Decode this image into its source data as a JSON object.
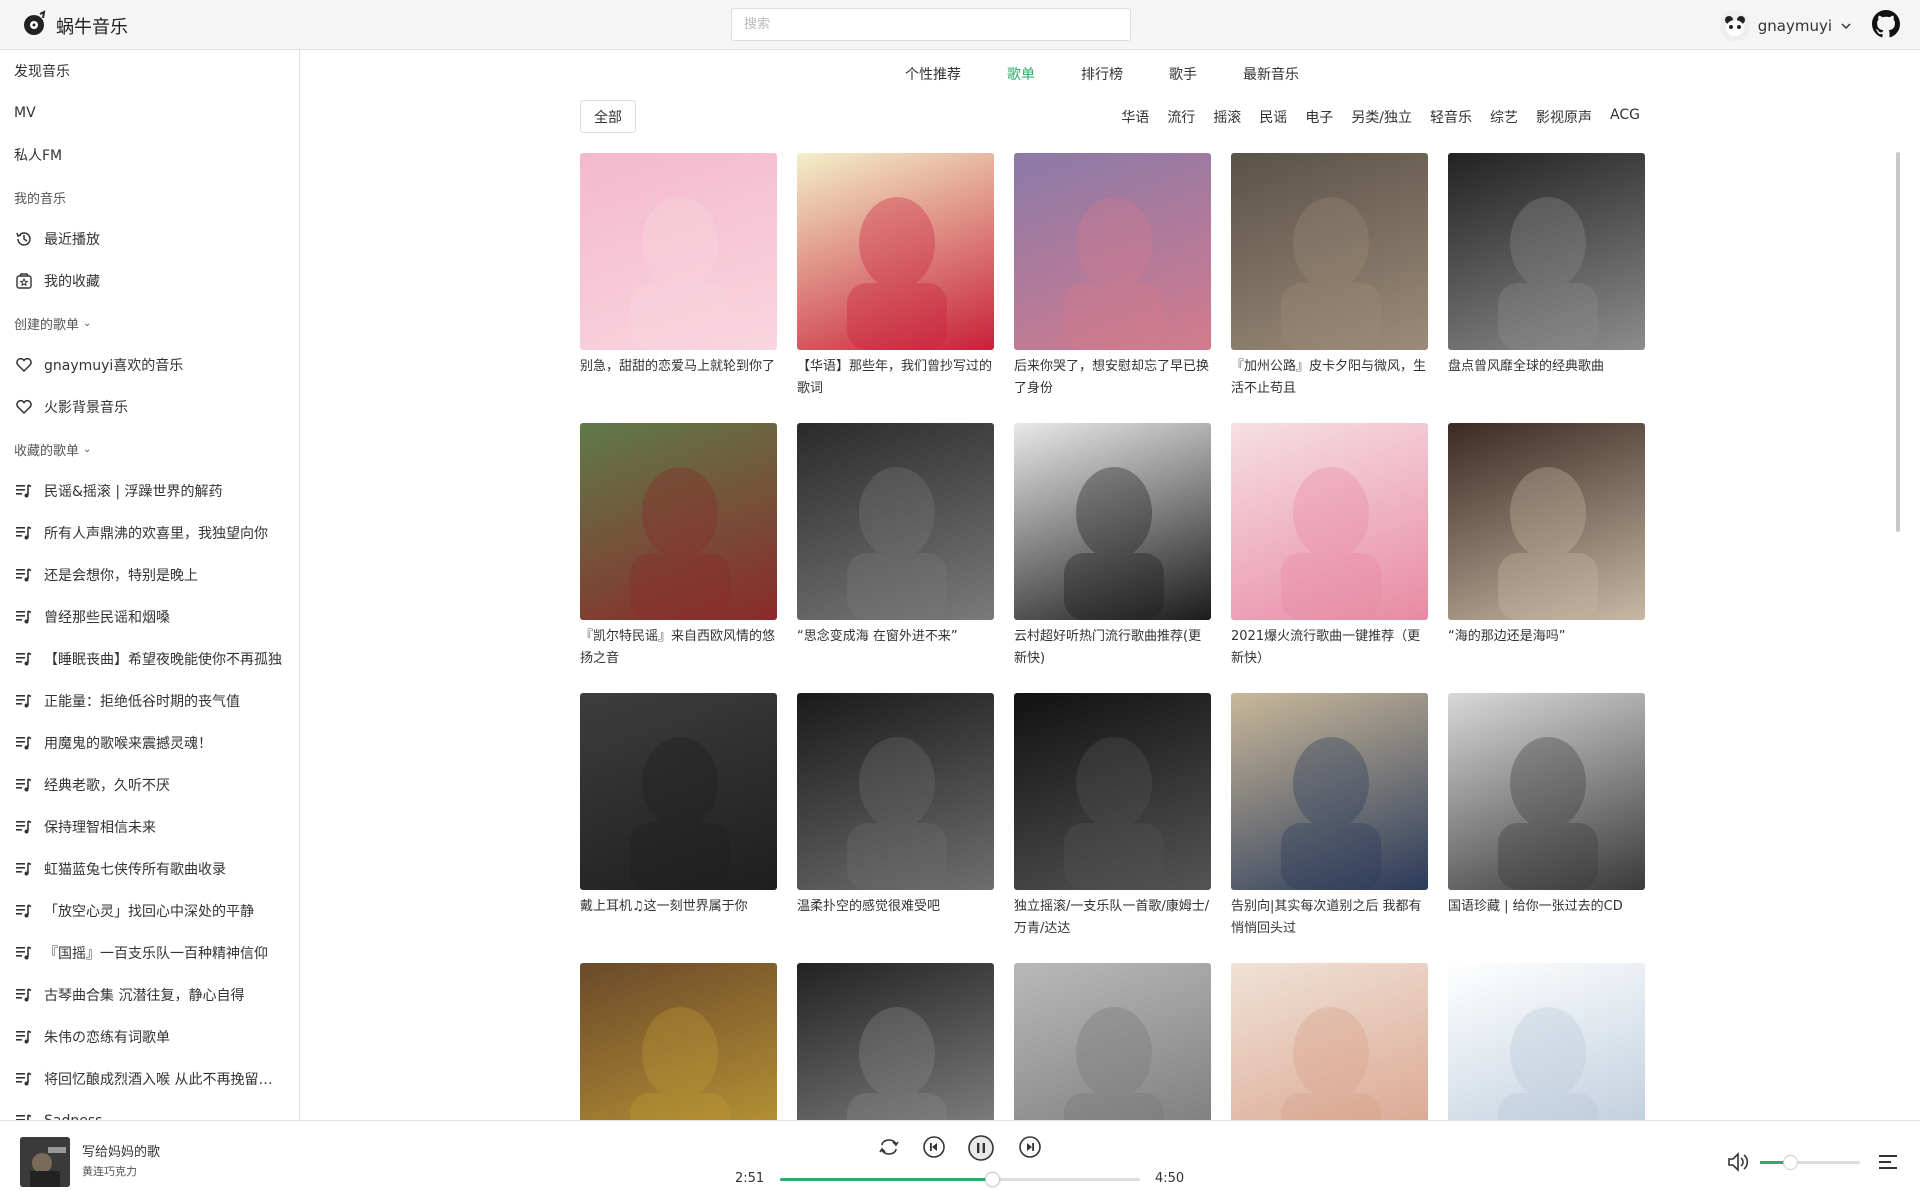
{
  "app": {
    "name": "蜗牛音乐"
  },
  "search": {
    "placeholder": "搜索"
  },
  "user": {
    "name": "gnaymuyi"
  },
  "sidebar": {
    "nav": [
      "发现音乐",
      "MV",
      "私人FM"
    ],
    "my_music_label": "我的音乐",
    "my_music": [
      {
        "label": "最近播放",
        "icon": "history-icon"
      },
      {
        "label": "我的收藏",
        "icon": "favorite-box-icon"
      }
    ],
    "created_label": "创建的歌单",
    "created": [
      "gnaymuyi喜欢的音乐",
      "火影背景音乐"
    ],
    "collected_label": "收藏的歌单",
    "collected": [
      "民谣&摇滚 | 浮躁世界的解药",
      "所有人声鼎沸的欢喜里，我独望向你",
      "还是会想你，特别是晚上",
      "曾经那些民谣和烟嗓",
      "【睡眠丧曲】希望夜晚能使你不再孤独",
      "正能量：拒绝低谷时期的丧气值",
      "用魔鬼的歌喉来震撼灵魂！",
      "经典老歌，久听不厌",
      "保持理智相信未来",
      "虹猫蓝兔七侠传所有歌曲收录",
      "「放空心灵」找回心中深处的平静",
      "『国摇』一百支乐队一百种精神信仰",
      "古琴曲合集 沉潜往复，静心自得",
      "朱伟の恋练有词歌单",
      "将回忆酿成烈酒入喉 从此不再挽留不...",
      "Sadness"
    ]
  },
  "tabs": [
    "个性推荐",
    "歌单",
    "排行榜",
    "歌手",
    "最新音乐"
  ],
  "active_tab": "歌单",
  "categories": {
    "all_label": "全部",
    "items": [
      "华语",
      "流行",
      "摇滚",
      "民谣",
      "电子",
      "另类/独立",
      "轻音乐",
      "综艺",
      "影视原声",
      "ACG"
    ]
  },
  "playlists": [
    {
      "title": "别急，甜甜的恋爱马上就轮到你了",
      "cover": [
        "#f4b8cc",
        "#f9d6e0"
      ]
    },
    {
      "title": "【华语】那些年，我们曾抄写过的歌词",
      "cover": [
        "#f3f0c9",
        "#c8203a"
      ]
    },
    {
      "title": "后来你哭了，想安慰却忘了早已换了身份",
      "cover": [
        "#8a7aa8",
        "#d37b8d"
      ]
    },
    {
      "title": "『加州公路』皮卡夕阳与微风，生活不止苟且",
      "cover": [
        "#5a5248",
        "#9c8b78"
      ]
    },
    {
      "title": "盘点曾风靡全球的经典歌曲",
      "cover": [
        "#222222",
        "#8c8c8c"
      ]
    },
    {
      "title": "『凯尔特民谣』来自西欧风情的悠扬之音",
      "cover": [
        "#5f7a4a",
        "#8b2a2a"
      ]
    },
    {
      "title": "“思念变成海 在窗外进不来”",
      "cover": [
        "#2a2a2a",
        "#7a7a7a"
      ]
    },
    {
      "title": "云村超好听热门流行歌曲推荐(更新快)",
      "cover": [
        "#e9e9e9",
        "#1b1b1b"
      ]
    },
    {
      "title": "2021爆火流行歌曲一键推荐（更新快）",
      "cover": [
        "#f6dfe5",
        "#e88aa4"
      ]
    },
    {
      "title": "“海的那边还是海吗”",
      "cover": [
        "#3a2a22",
        "#c9b8a4"
      ]
    },
    {
      "title": "戴上耳机♫这一刻世界属于你",
      "cover": [
        "#3d3d3d",
        "#1e1e1e"
      ]
    },
    {
      "title": "温柔扑空的感觉很难受吧",
      "cover": [
        "#1a1a1a",
        "#6e6e6e"
      ]
    },
    {
      "title": "独立摇滚/一支乐队一首歌/康姆士/万青/达达",
      "cover": [
        "#111111",
        "#545454"
      ]
    },
    {
      "title": "告别向|其实每次道别之后 我都有悄悄回头过",
      "cover": [
        "#c9b99a",
        "#2b3a5a"
      ]
    },
    {
      "title": "国语珍藏 | 给你一张过去的CD",
      "cover": [
        "#d9d9d9",
        "#3a3a3a"
      ]
    },
    {
      "title": "",
      "cover": [
        "#6a4a2a",
        "#c09a36"
      ]
    },
    {
      "title": "",
      "cover": [
        "#222222",
        "#8a8a8a"
      ]
    },
    {
      "title": "",
      "cover": [
        "#b9b9b9",
        "#777777"
      ]
    },
    {
      "title": "",
      "cover": [
        "#f0e2d6",
        "#d8a08a"
      ]
    },
    {
      "title": "",
      "cover": [
        "#ffffff",
        "#b8c8d8"
      ]
    }
  ],
  "player": {
    "song": "写给妈妈的歌",
    "artist": "黄连巧克力",
    "current_time": "2:51",
    "total_time": "4:50",
    "progress": 0.59,
    "volume": 0.3,
    "accent": "#33a868"
  }
}
